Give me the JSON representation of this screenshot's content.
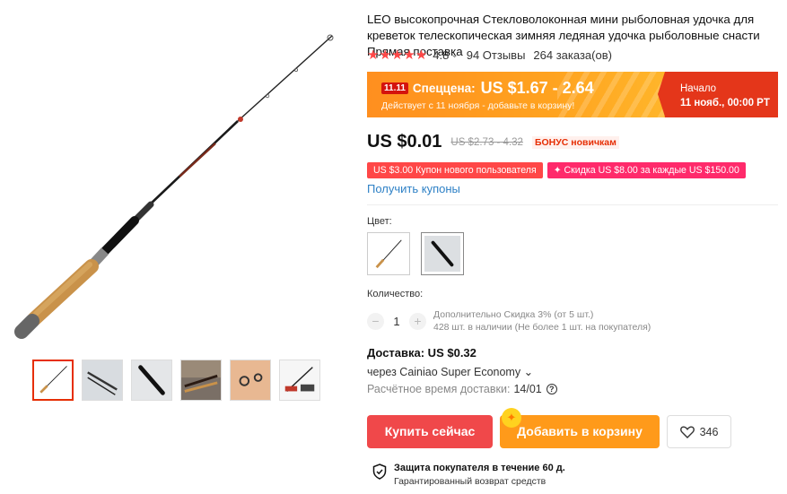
{
  "product": {
    "title": "LEO высокопрочная Стекловолоконная мини рыболовная удочка для креветок телескопическая зимняя ледяная удочка рыболовные снасти Прямая поставка",
    "rating": {
      "stars": "★★★★★",
      "value": "4.8",
      "chevron": "⌄",
      "reviews": "94 Отзывы",
      "orders": "264 заказа(ов)"
    }
  },
  "sale": {
    "badge": "11.11",
    "label": "Спеццена:",
    "price": "US $1.67 - 2.64",
    "subtitle": "Действует с 11 ноября - добавьте в корзину!",
    "start_label": "Начало",
    "start_date": "11 нояб., 00:00 PT"
  },
  "price": {
    "current": "US $0.01",
    "original": "US $2.73 - 4.32",
    "bonus": "БОНУС новичкам"
  },
  "coupons": {
    "coupon1": "US $3.00 Купон нового пользователя",
    "coupon2": "✦ Скидка US $8.00 за каждые US $150.00",
    "get_link": "Получить купоны"
  },
  "color": {
    "label": "Цвет:"
  },
  "quantity": {
    "label": "Количество:",
    "minus": "−",
    "value": "1",
    "plus": "+",
    "discount": "Дополнительно Скидка 3% (от 5 шт.)",
    "stock": "428 шт. в наличии (Не более 1 шт. на покупателя)"
  },
  "shipping": {
    "title": "Доставка: US $0.32",
    "via": "через Cainiao Super Economy ⌄",
    "eta_label": "Расчётное время доставки:",
    "eta_value": "14/01",
    "help": "?"
  },
  "actions": {
    "buy": "Купить сейчас",
    "cart": "Добавить в корзину",
    "wishlist_count": "346"
  },
  "protection": {
    "title": "Защита покупателя в течение 60 д.",
    "subtitle": "Гарантированный возврат средств"
  },
  "colors": {
    "accent": "#ff4747",
    "sale_orange": "#ff9a1a",
    "sale_red": "#e4361a",
    "link": "#2e81c6"
  },
  "icons": {
    "wishlist": "heart-icon",
    "protection": "shield-check-icon",
    "help": "question-circle-icon"
  }
}
